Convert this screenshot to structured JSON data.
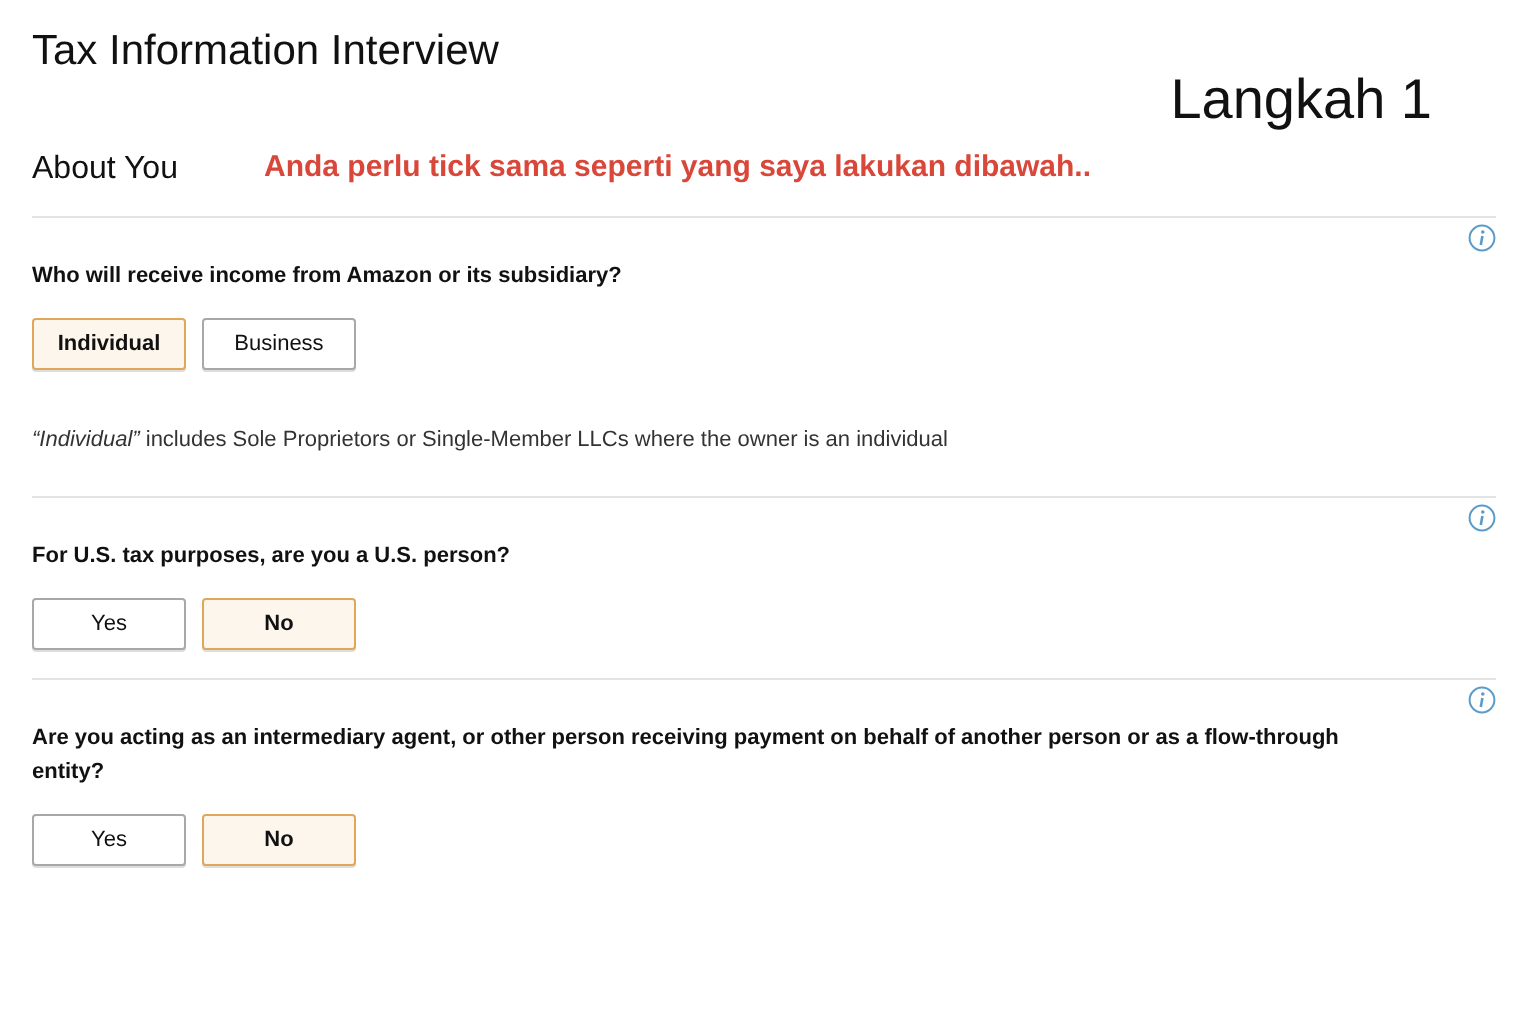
{
  "title": "Tax Information Interview",
  "step_label": "Langkah 1",
  "section_title": "About You",
  "annotation": "Anda perlu tick sama seperti yang saya lakukan dibawah..",
  "questions": [
    {
      "text": "Who will receive income from Amazon or its subsidiary?",
      "options": [
        {
          "label": "Individual",
          "selected": true
        },
        {
          "label": "Business",
          "selected": false
        }
      ],
      "note": "*“Individual”* includes Sole Proprietors or Single-Member LLCs where the owner is an individual"
    },
    {
      "text": "For U.S. tax purposes, are you a U.S. person?",
      "options": [
        {
          "label": "Yes",
          "selected": false
        },
        {
          "label": "No",
          "selected": true
        }
      ]
    },
    {
      "text": "Are you acting as an intermediary agent, or other person receiving payment on behalf of another person or as a flow-through entity?",
      "options": [
        {
          "label": "Yes",
          "selected": false
        },
        {
          "label": "No",
          "selected": true
        }
      ]
    }
  ]
}
